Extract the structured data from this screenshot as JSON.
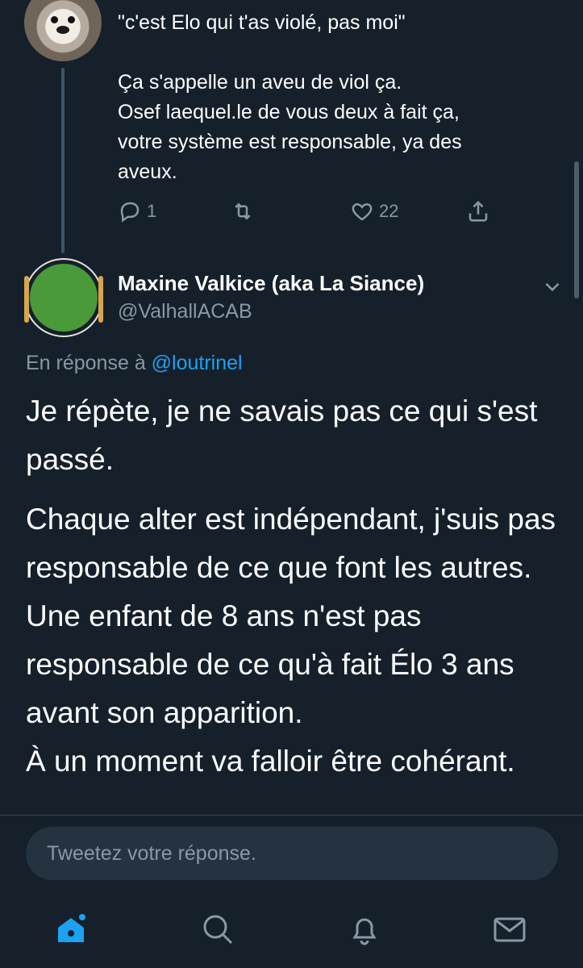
{
  "parent_tweet": {
    "text": "\"c'est Elo qui t'as violé, pas moi\"\n\nÇa s'appelle un aveu de viol ça.\nOsef laequel.le de vous deux à fait ça,\nvotre système est responsable, ya des\naveux.",
    "reply_count": "1",
    "like_count": "22"
  },
  "tweet": {
    "display_name": "Maxine Valkice (aka La Siance)",
    "handle": "@ValhallACAB",
    "reply_to_prefix": "En réponse à",
    "reply_to_mention": "@loutrinel",
    "paragraphs": [
      "Je répète, je ne savais pas ce qui s'est passé.",
      "Chaque alter est indépendant, j'suis pas responsable de ce que font les autres. Une enfant de 8 ans n'est pas responsable de ce qu'à fait Élo 3 ans avant son apparition.\nÀ un moment va falloir être cohérant."
    ]
  },
  "reply_box": {
    "placeholder": "Tweetez votre réponse."
  },
  "tabbar": {
    "items": [
      "home-icon",
      "search-icon",
      "notifications-icon",
      "messages-icon"
    ],
    "active": "home-icon"
  },
  "colors": {
    "background": "#15202b",
    "accent": "#1da1f2",
    "secondary_text": "#8899a6"
  }
}
